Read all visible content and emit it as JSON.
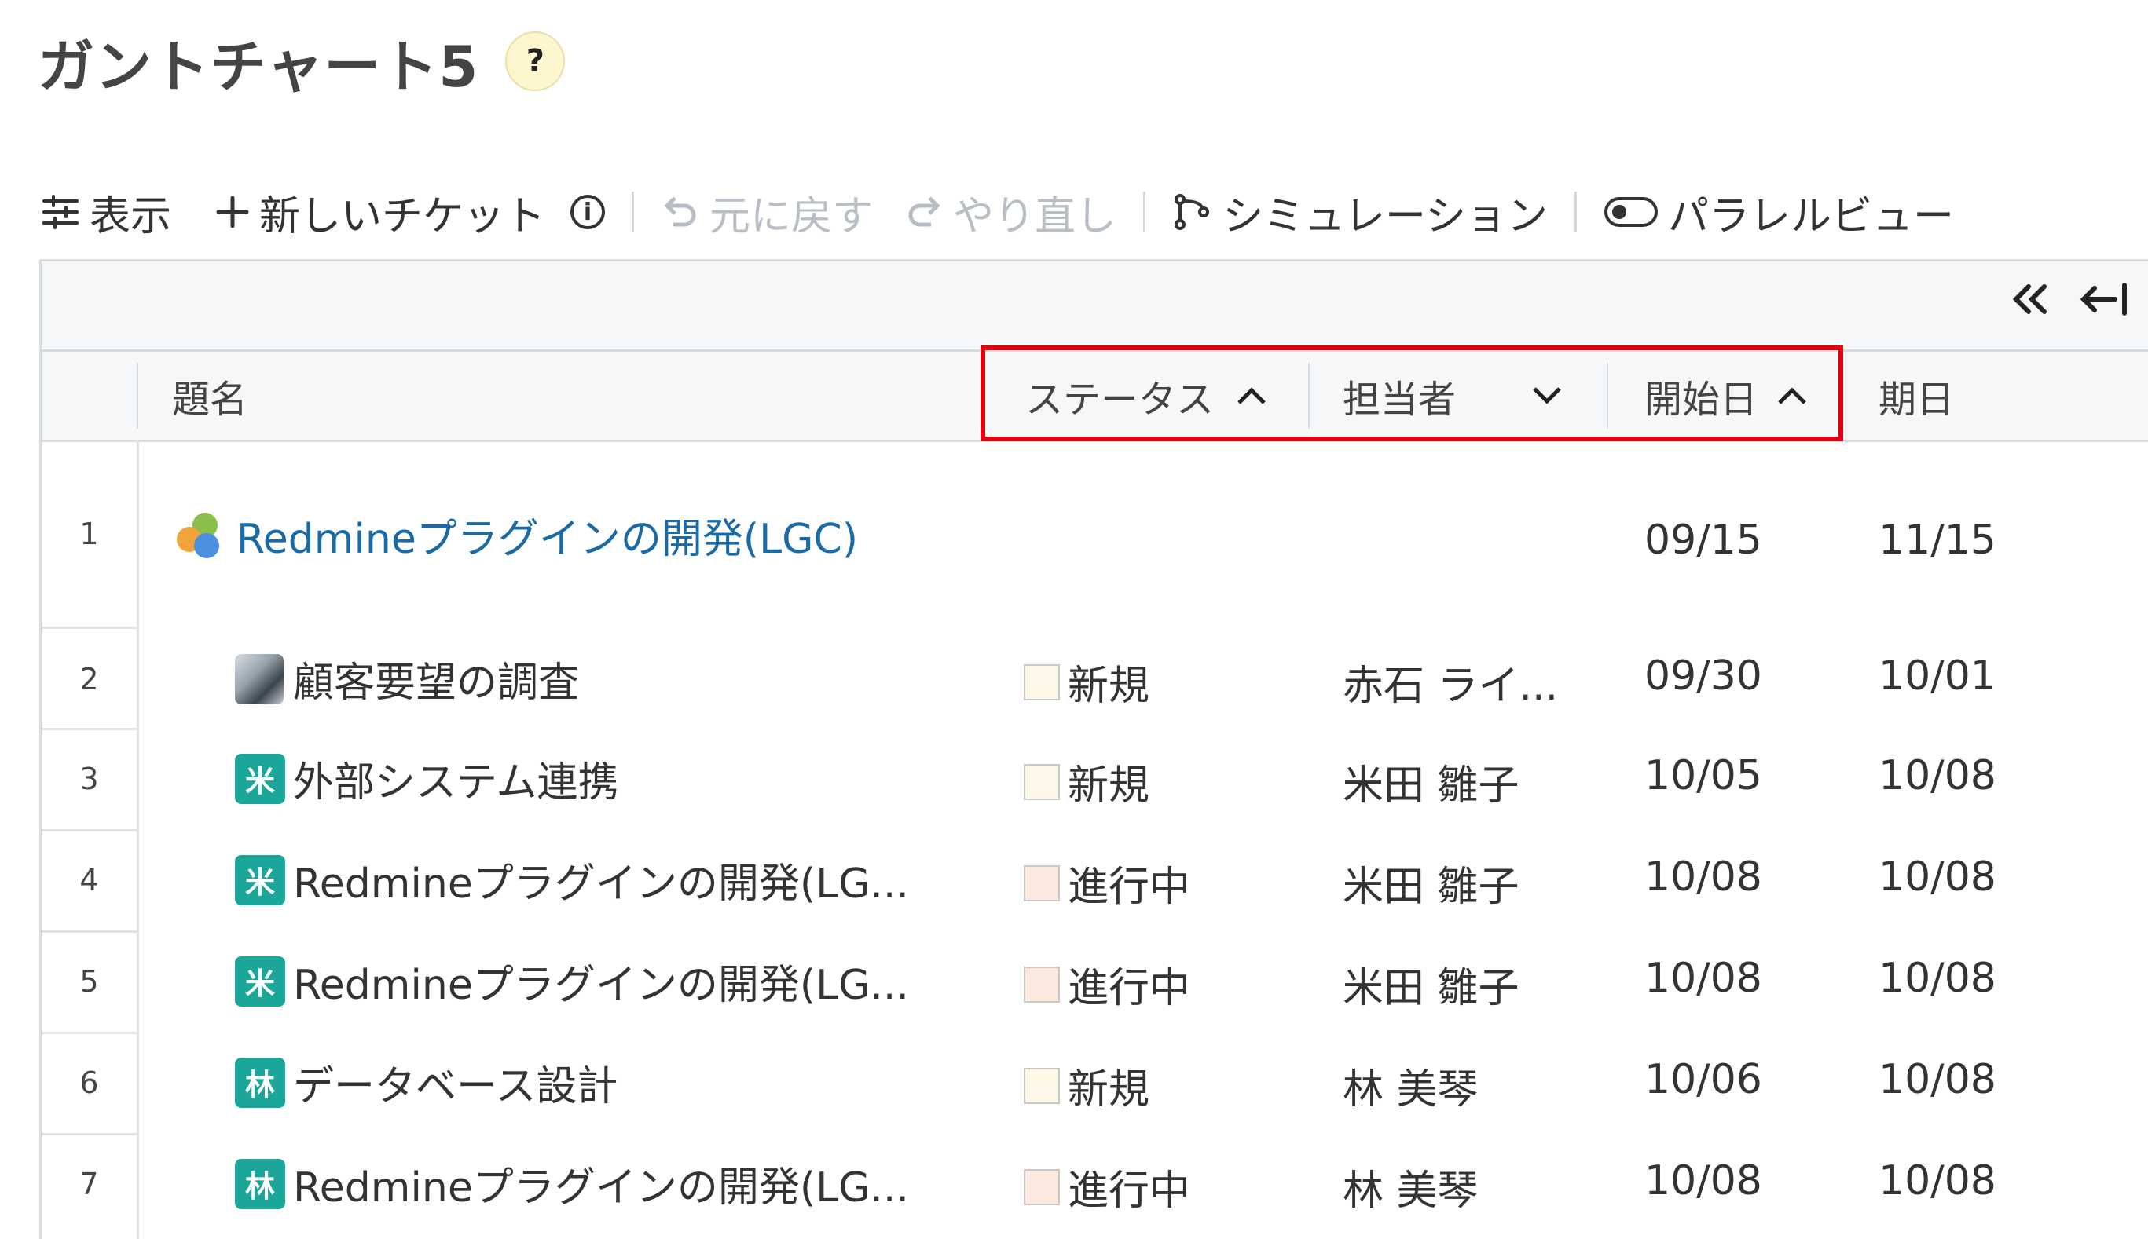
{
  "page": {
    "title": "ガントチャート5",
    "help_label": "?"
  },
  "toolbar": {
    "display_label": "表示",
    "new_ticket_label": "新しいチケット",
    "info_label": "i",
    "undo_label": "元に戻す",
    "redo_label": "やり直し",
    "simulation_label": "シミュレーション",
    "parallel_view_label": "パラレルビュー"
  },
  "columns": {
    "subject": "題名",
    "status": "ステータス",
    "assignee": "担当者",
    "start_date": "開始日",
    "due_date": "期日"
  },
  "rows": [
    {
      "num": "1",
      "subject": "Redmineプラグインの開発(LGC)",
      "status": "",
      "assignee": "",
      "start": "09/15",
      "due": "11/15"
    },
    {
      "num": "2",
      "subject": "顧客要望の調査",
      "status": "新規",
      "assignee": "赤石 ライ...",
      "start": "09/30",
      "due": "10/01"
    },
    {
      "num": "3",
      "badge": "米",
      "subject": "外部システム連携",
      "status": "新規",
      "assignee": "米田 雛子",
      "start": "10/05",
      "due": "10/08"
    },
    {
      "num": "4",
      "badge": "米",
      "subject": "Redmineプラグインの開発(LG...",
      "status": "進行中",
      "assignee": "米田 雛子",
      "start": "10/08",
      "due": "10/08"
    },
    {
      "num": "5",
      "badge": "米",
      "subject": "Redmineプラグインの開発(LG...",
      "status": "進行中",
      "assignee": "米田 雛子",
      "start": "10/08",
      "due": "10/08"
    },
    {
      "num": "6",
      "badge": "林",
      "subject": "データベース設計",
      "status": "新規",
      "assignee": "林 美琴",
      "start": "10/06",
      "due": "10/08"
    },
    {
      "num": "7",
      "badge": "林",
      "subject": "Redmineプラグインの開発(LG...",
      "status": "進行中",
      "assignee": "林 美琴",
      "start": "10/08",
      "due": "10/08"
    }
  ],
  "colors": {
    "accent_link": "#1a6aa6",
    "badge_teal": "#1aa79a",
    "highlight_red": "#e0000f",
    "status_new_fill": "#fdf7e8",
    "status_inprogress_fill": "#fbe8df"
  }
}
